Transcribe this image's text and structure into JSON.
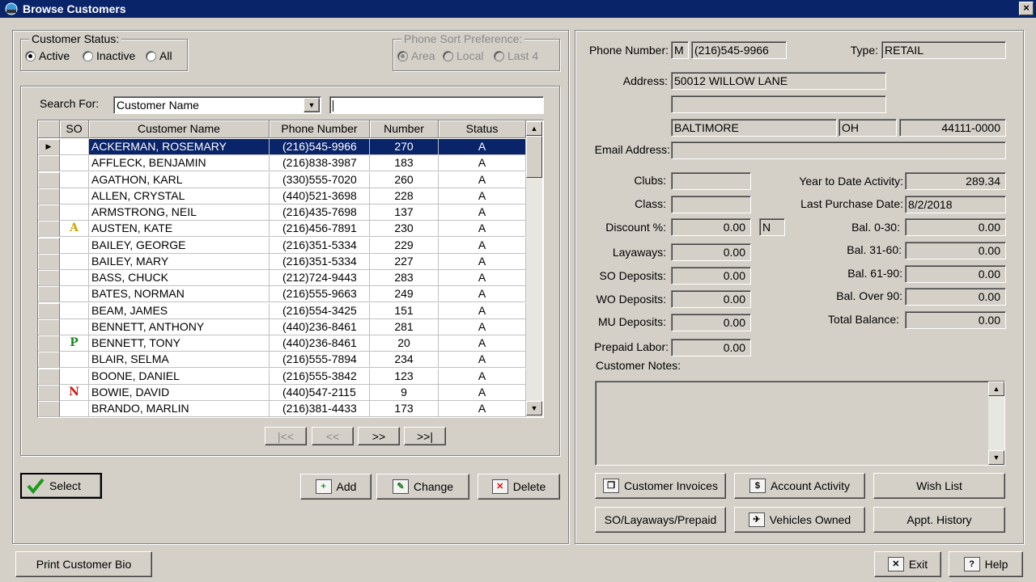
{
  "window": {
    "title": "Browse Customers",
    "close_glyph": "×"
  },
  "left": {
    "status_group": {
      "legend": "Customer Status:",
      "options": [
        {
          "label": "Active",
          "selected": true
        },
        {
          "label": "Inactive",
          "selected": false
        },
        {
          "label": "All",
          "selected": false
        }
      ]
    },
    "phone_sort_group": {
      "legend": "Phone Sort Preference:",
      "options": [
        {
          "label": "Area",
          "selected": true
        },
        {
          "label": "Local",
          "selected": false
        },
        {
          "label": "Last 4",
          "selected": false
        }
      ]
    },
    "search": {
      "label": "Search For:",
      "field_value": "Customer Name",
      "text_value": ""
    },
    "grid": {
      "columns": [
        "SO",
        "Customer Name",
        "Phone Number",
        "Number",
        "Status"
      ],
      "rows": [
        {
          "so": "",
          "name": "ACKERMAN, ROSEMARY",
          "phone": "(216)545-9966",
          "number": "270",
          "status": "A",
          "selected": true
        },
        {
          "so": "",
          "name": "AFFLECK, BENJAMIN",
          "phone": "(216)838-3987",
          "number": "183",
          "status": "A"
        },
        {
          "so": "",
          "name": "AGATHON, KARL",
          "phone": "(330)555-7020",
          "number": "260",
          "status": "A"
        },
        {
          "so": "",
          "name": "ALLEN, CRYSTAL",
          "phone": "(440)521-3698",
          "number": "228",
          "status": "A"
        },
        {
          "so": "",
          "name": "ARMSTRONG, NEIL",
          "phone": "(216)435-7698",
          "number": "137",
          "status": "A"
        },
        {
          "so": "A",
          "so_color": "#c8a800",
          "name": "AUSTEN, KATE",
          "phone": "(216)456-7891",
          "number": "230",
          "status": "A"
        },
        {
          "so": "",
          "name": "BAILEY, GEORGE",
          "phone": "(216)351-5334",
          "number": "229",
          "status": "A"
        },
        {
          "so": "",
          "name": "BAILEY, MARY",
          "phone": "(216)351-5334",
          "number": "227",
          "status": "A"
        },
        {
          "so": "",
          "name": "BASS, CHUCK",
          "phone": "(212)724-9443",
          "number": "283",
          "status": "A"
        },
        {
          "so": "",
          "name": "BATES, NORMAN",
          "phone": "(216)555-9663",
          "number": "249",
          "status": "A"
        },
        {
          "so": "",
          "name": "BEAM, JAMES",
          "phone": "(216)554-3425",
          "number": "151",
          "status": "A"
        },
        {
          "so": "",
          "name": "BENNETT, ANTHONY",
          "phone": "(440)236-8461",
          "number": "281",
          "status": "A"
        },
        {
          "so": "P",
          "so_color": "#1a8a1a",
          "name": "BENNETT, TONY",
          "phone": "(440)236-8461",
          "number": "20",
          "status": "A"
        },
        {
          "so": "",
          "name": "BLAIR, SELMA",
          "phone": "(216)555-7894",
          "number": "234",
          "status": "A"
        },
        {
          "so": "",
          "name": "BOONE, DANIEL",
          "phone": "(216)555-3842",
          "number": "123",
          "status": "A"
        },
        {
          "so": "N",
          "so_color": "#d01010",
          "name": "BOWIE, DAVID",
          "phone": "(440)547-2115",
          "number": "9",
          "status": "A"
        },
        {
          "so": "",
          "name": "BRANDO, MARLIN",
          "phone": "(216)381-4433",
          "number": "173",
          "status": "A"
        }
      ]
    },
    "nav": {
      "first": "|<<",
      "prev": "<<",
      "next": ">>",
      "last": ">>|"
    },
    "buttons": {
      "select": "Select",
      "add": "Add",
      "change": "Change",
      "delete": "Delete",
      "print_bio": "Print Customer Bio"
    }
  },
  "right": {
    "phone_label": "Phone Number:",
    "phone_type": "M",
    "phone": "(216)545-9966",
    "type_label": "Type:",
    "type": "RETAIL",
    "address_label": "Address:",
    "address1": "50012 WILLOW LANE",
    "address2": "",
    "city": "BALTIMORE",
    "state": "OH",
    "zip": "44111-0000",
    "email_label": "Email Address:",
    "email": "",
    "clubs_label": "Clubs:",
    "clubs": "",
    "class_label": "Class:",
    "class": "",
    "discount_label": "Discount %:",
    "discount": "0.00",
    "discount_flag": "N",
    "layaways_label": "Layaways:",
    "layaways": "0.00",
    "so_deposits_label": "SO Deposits:",
    "so_deposits": "0.00",
    "wo_deposits_label": "WO Deposits:",
    "wo_deposits": "0.00",
    "mu_deposits_label": "MU Deposits:",
    "mu_deposits": "0.00",
    "prepaid_labor_label": "Prepaid Labor:",
    "prepaid_labor": "0.00",
    "ytd_label": "Year to Date Activity:",
    "ytd": "289.34",
    "last_purchase_label": "Last Purchase Date:",
    "last_purchase": "8/2/2018",
    "bal_0_30_label": "Bal. 0-30:",
    "bal_0_30": "0.00",
    "bal_31_60_label": "Bal. 31-60:",
    "bal_31_60": "0.00",
    "bal_61_90_label": "Bal. 61-90:",
    "bal_61_90": "0.00",
    "bal_over_90_label": "Bal. Over 90:",
    "bal_over_90": "0.00",
    "total_balance_label": "Total Balance:",
    "total_balance": "0.00",
    "notes_label": "Customer Notes:",
    "notes": "",
    "buttons": {
      "invoices": "Customer Invoices",
      "account_activity": "Account Activity",
      "wish_list": "Wish List",
      "so_layaways": "SO/Layaways/Prepaid",
      "vehicles": "Vehicles Owned",
      "appt_history": "Appt. History"
    }
  },
  "footer": {
    "exit": "Exit",
    "help": "Help"
  }
}
